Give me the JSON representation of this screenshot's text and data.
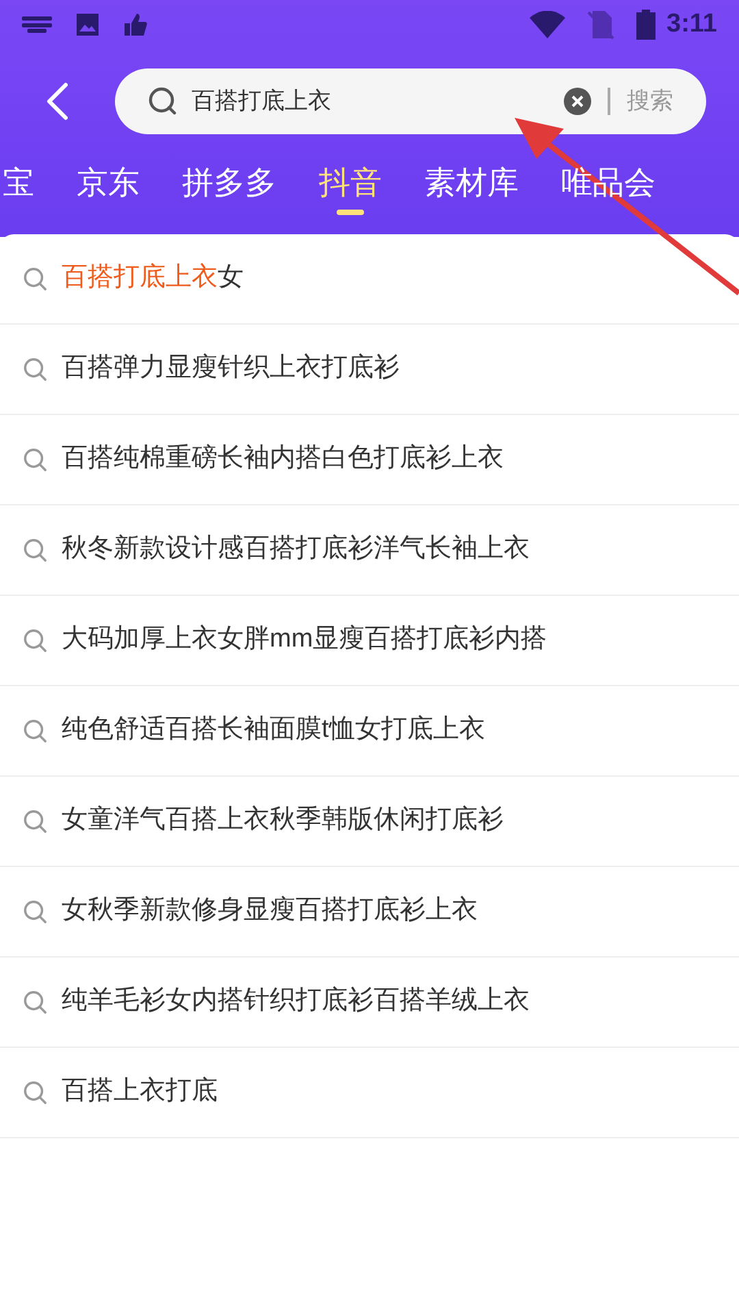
{
  "status_bar": {
    "time": "3:11"
  },
  "search": {
    "value": "百搭打底上衣",
    "button": "搜索"
  },
  "tabs": [
    {
      "label": "宝",
      "selected": false
    },
    {
      "label": "京东",
      "selected": false
    },
    {
      "label": "拼多多",
      "selected": false
    },
    {
      "label": "抖音",
      "selected": true
    },
    {
      "label": "素材库",
      "selected": false
    },
    {
      "label": "唯品会",
      "selected": false
    }
  ],
  "suggestions": [
    {
      "highlight": "百搭打底上衣",
      "rest": "女"
    },
    {
      "rest": "百搭弹力显瘦针织上衣打底衫"
    },
    {
      "rest": "百搭纯棉重磅长袖内搭白色打底衫上衣"
    },
    {
      "rest": "秋冬新款设计感百搭打底衫洋气长袖上衣"
    },
    {
      "rest": "大码加厚上衣女胖mm显瘦百搭打底衫内搭"
    },
    {
      "rest": "纯色舒适百搭长袖面膜t恤女打底上衣"
    },
    {
      "rest": "女童洋气百搭上衣秋季韩版休闲打底衫"
    },
    {
      "rest": "女秋季新款修身显瘦百搭打底衫上衣"
    },
    {
      "rest": "纯羊毛衫女内搭针织打底衫百搭羊绒上衣"
    },
    {
      "rest": "百搭上衣打底"
    }
  ]
}
